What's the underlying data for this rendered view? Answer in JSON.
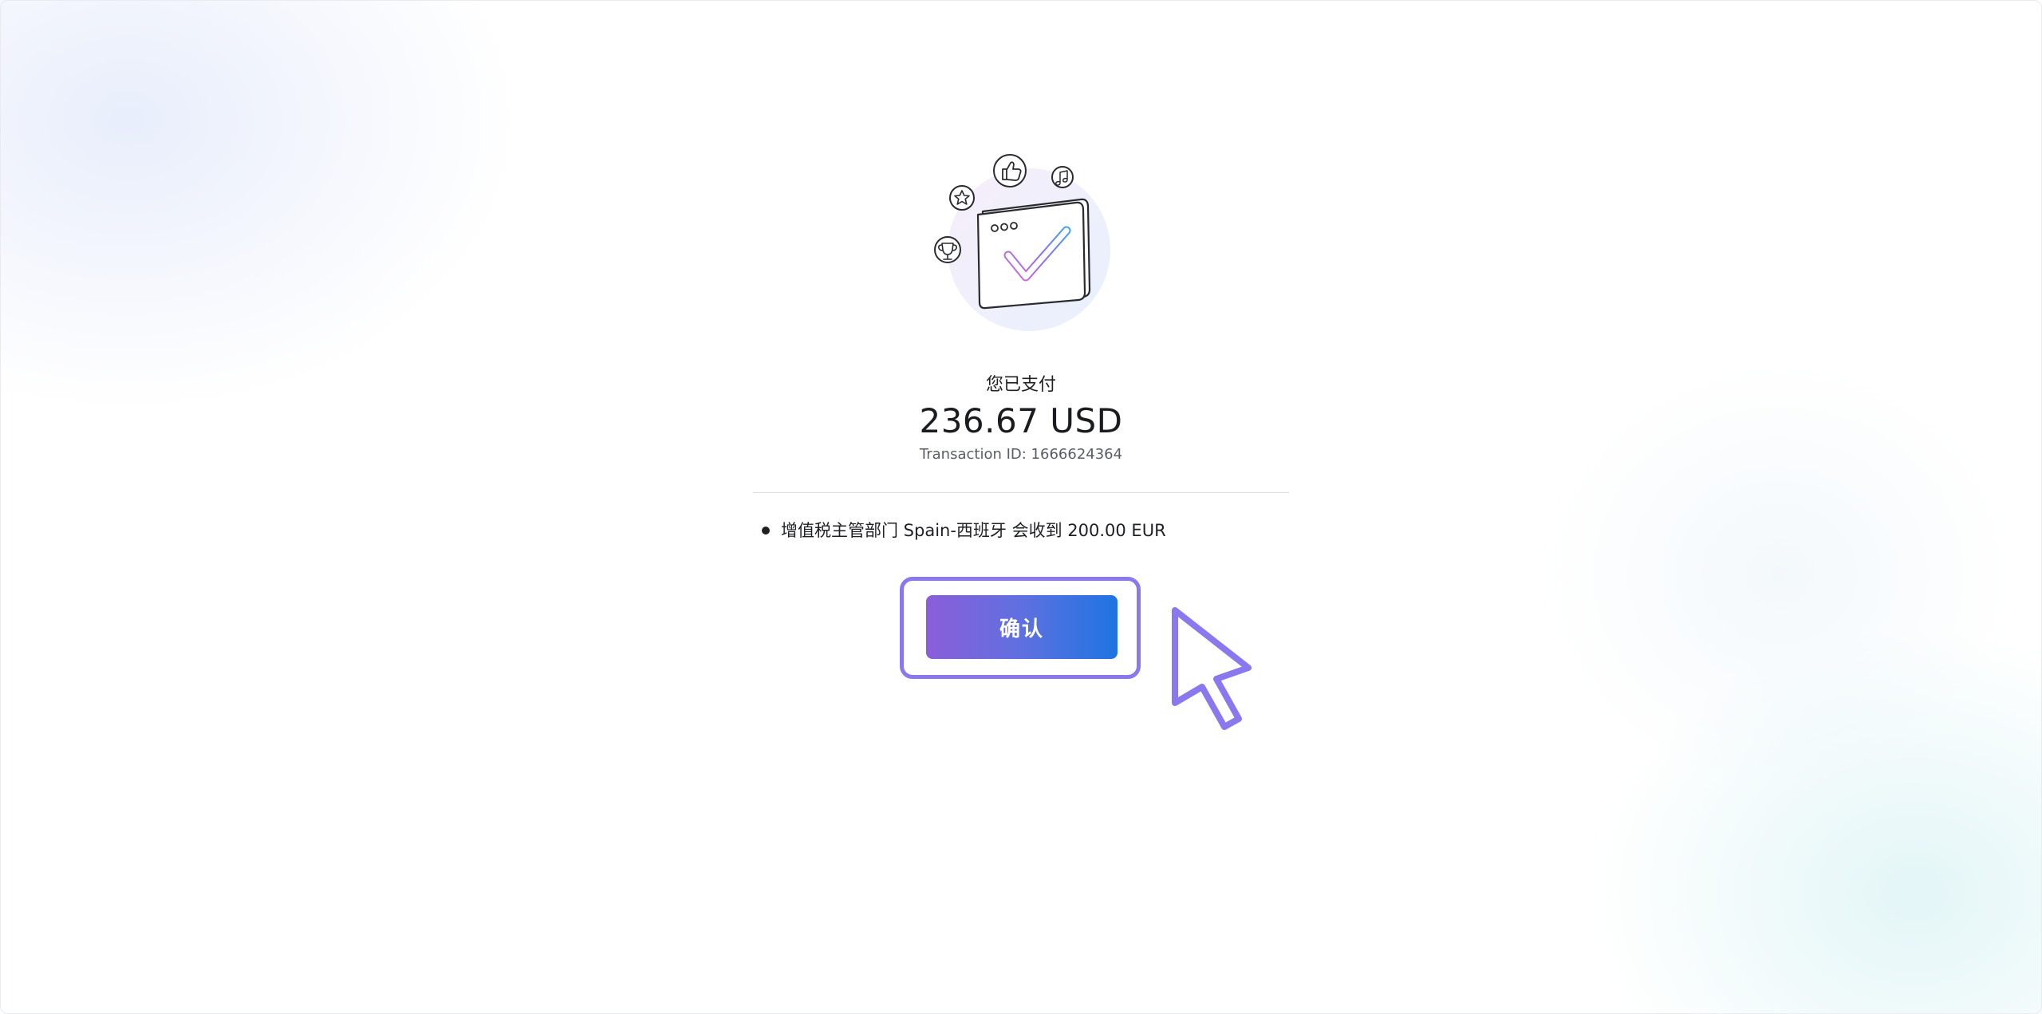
{
  "payment": {
    "paid_label": "您已支付",
    "amount": "236.67 USD",
    "transaction_id": "Transaction ID: 1666624364"
  },
  "details": {
    "items": [
      "增值税主管部门 Spain-西班牙 会收到 200.00 EUR"
    ]
  },
  "actions": {
    "confirm_label": "确认"
  },
  "colors": {
    "button_gradient_start": "#8b5ed9",
    "button_gradient_end": "#1e74e2",
    "highlight_outline": "#8a78ee",
    "cursor": "#8a78ee"
  },
  "icons": {
    "illustration": "payment-success-illustration",
    "illustration_badges": [
      "thumbs-up-icon",
      "star-icon",
      "trophy-icon",
      "music-note-icon",
      "checkmark-icon"
    ],
    "pointer": "cursor-arrow-icon"
  }
}
